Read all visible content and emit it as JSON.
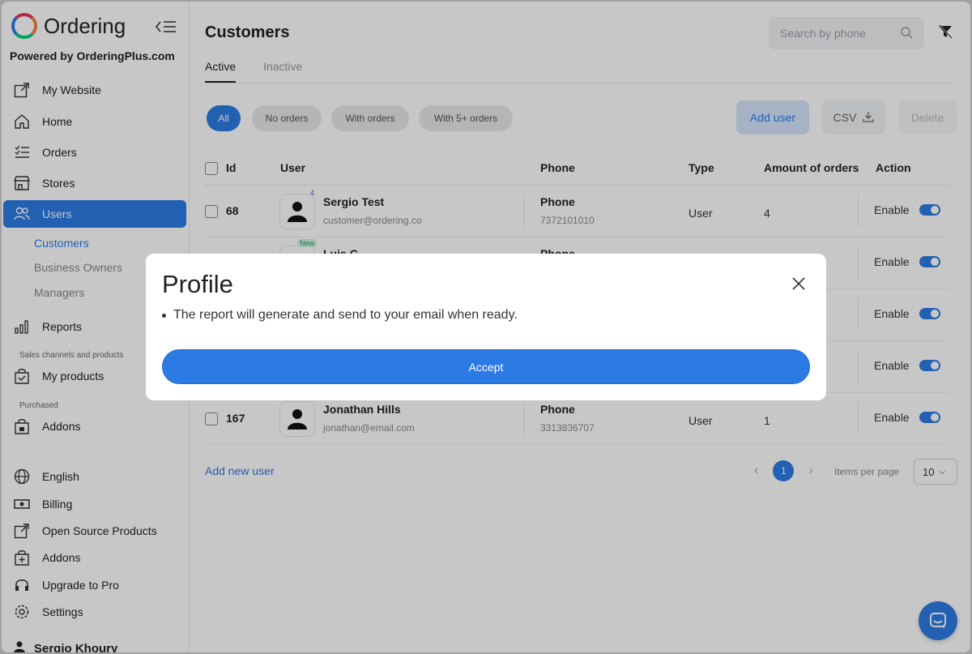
{
  "app": {
    "name": "Ordering",
    "powered_by": "Powered by OrderingPlus.com"
  },
  "sidebar": {
    "items": [
      {
        "label": "My Website",
        "icon": "external-link-icon"
      },
      {
        "label": "Home",
        "icon": "home-icon"
      },
      {
        "label": "Orders",
        "icon": "list-icon"
      },
      {
        "label": "Stores",
        "icon": "store-icon"
      },
      {
        "label": "Users",
        "icon": "users-icon",
        "active": true
      },
      {
        "label": "Reports",
        "icon": "bar-chart-icon"
      },
      {
        "label": "My products",
        "icon": "bag-check-icon"
      },
      {
        "label": "Addons",
        "icon": "bag-lock-icon"
      },
      {
        "label": "English",
        "icon": "globe-icon"
      },
      {
        "label": "Billing",
        "icon": "cash-icon"
      },
      {
        "label": "Open Source Products",
        "icon": "external-link-icon"
      },
      {
        "label": "Addons",
        "icon": "bag-plus-icon"
      },
      {
        "label": "Upgrade to Pro",
        "icon": "headset-icon"
      },
      {
        "label": "Settings",
        "icon": "gear-icon"
      }
    ],
    "sub_items": [
      "Customers",
      "Business Owners",
      "Managers"
    ],
    "section_sales": "Sales channels and products",
    "section_purchased": "Purchased",
    "user_name": "Sergio Khoury"
  },
  "main": {
    "title": "Customers",
    "search_placeholder": "Search by phone",
    "tabs": [
      "Active",
      "Inactive"
    ],
    "chips": [
      "All",
      "No orders",
      "With orders",
      "With 5+ orders"
    ],
    "buttons": {
      "add_user": "Add user",
      "csv": "CSV",
      "delete": "Delete"
    },
    "columns": [
      "Id",
      "User",
      "Phone",
      "Type",
      "Amount of orders",
      "Action"
    ],
    "rows": [
      {
        "id": "68",
        "name": "Sergio Test",
        "email": "customer@ordering.co",
        "phone_label": "Phone",
        "phone": "7372101010",
        "type": "User",
        "amount": "4",
        "action": "Enable",
        "badge": "4"
      },
      {
        "id": "",
        "name": "Luis G",
        "email": "",
        "phone_label": "Phone",
        "phone": "",
        "type": "",
        "amount": "",
        "action": "Enable",
        "badge": "New"
      },
      {
        "id": "",
        "name": "",
        "email": "",
        "phone_label": "",
        "phone": "",
        "type": "",
        "amount": "",
        "action": "Enable",
        "badge": ""
      },
      {
        "id": "",
        "name": "",
        "email": "",
        "phone_label": "",
        "phone": "",
        "type": "",
        "amount": "",
        "action": "Enable",
        "badge": ""
      },
      {
        "id": "167",
        "name": "Jonathan Hills",
        "email": "jonathan@email.com",
        "phone_label": "Phone",
        "phone": "3313836707",
        "type": "User",
        "amount": "1",
        "action": "Enable",
        "badge": ""
      }
    ],
    "add_new_user": "Add new user",
    "pagination": {
      "current": "1",
      "items_per_page_label": "Items per page",
      "items_per_page": "10"
    }
  },
  "modal": {
    "title": "Profile",
    "message": "The report will generate and send to your email when ready.",
    "accept": "Accept"
  },
  "colors": {
    "accent": "#2c7be5"
  }
}
